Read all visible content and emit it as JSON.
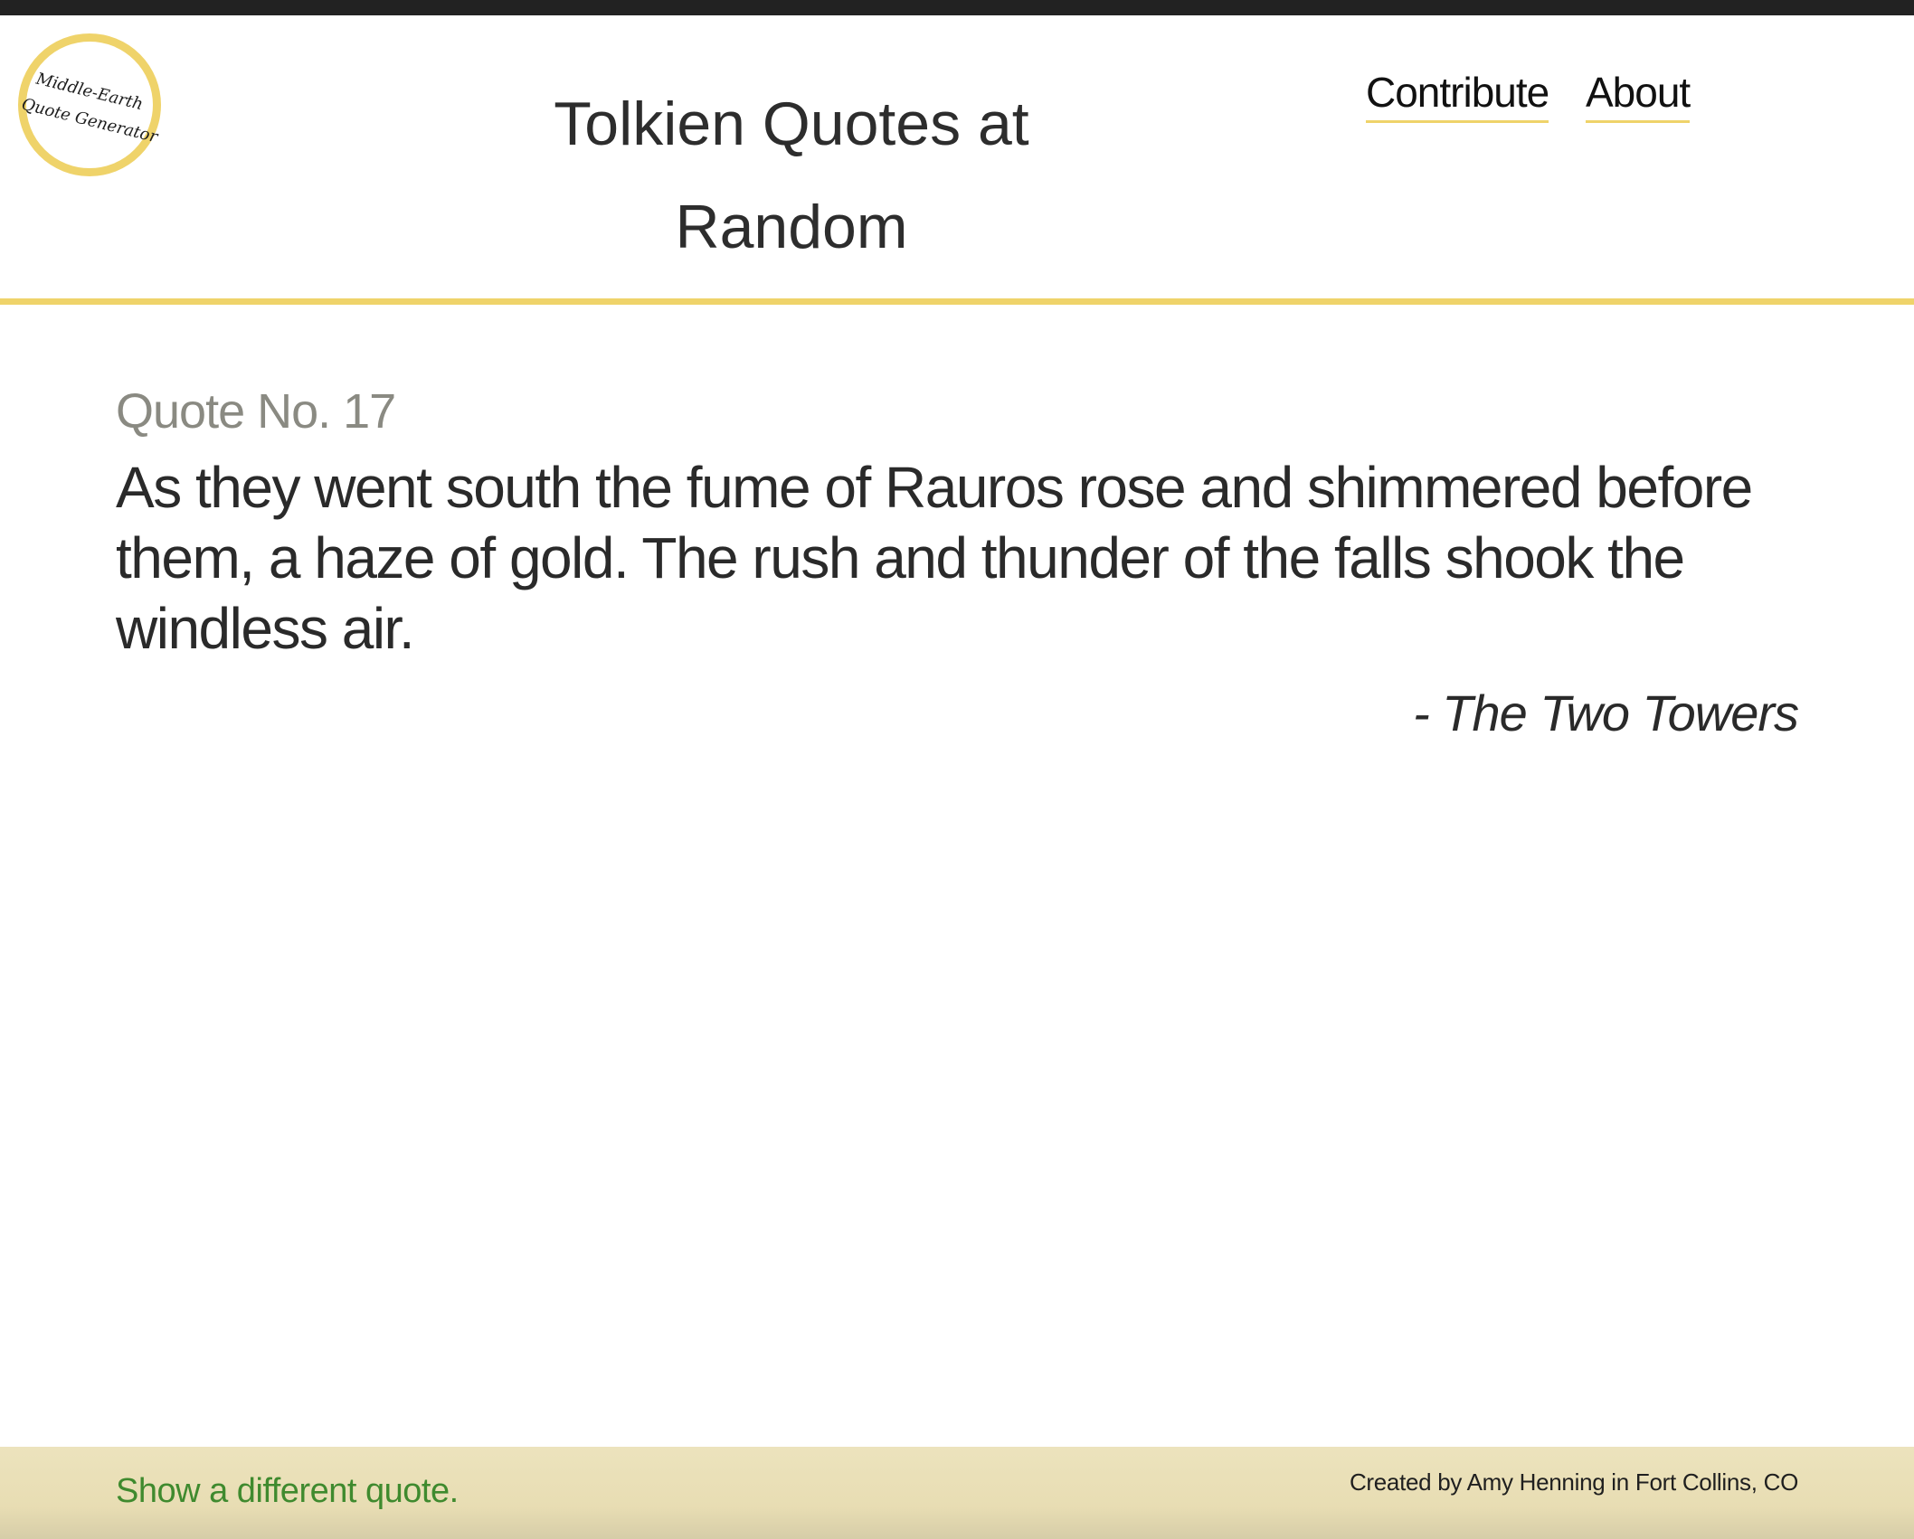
{
  "header": {
    "logo": {
      "line1": "Middle-Earth",
      "line2": "Quote Generator"
    },
    "title": "Tolkien Quotes at Random",
    "nav": {
      "contribute": "Contribute",
      "about": "About"
    }
  },
  "quote": {
    "number_label": "Quote No. 17",
    "text": "As they went south the fume of Rauros rose and shimmered before them, a haze of gold. The rush and thunder of the falls shook the windless air.",
    "source": "- The Two Towers"
  },
  "footer": {
    "new_quote_link": "Show a different quote.",
    "credit": "Created by Amy Henning in Fort Collins, CO"
  },
  "colors": {
    "accent": "#efd36a",
    "top_strip": "#222222",
    "footer_bg": "#e8ddb3",
    "link_green": "#3f8a2e",
    "muted_text": "#8a8a82"
  }
}
